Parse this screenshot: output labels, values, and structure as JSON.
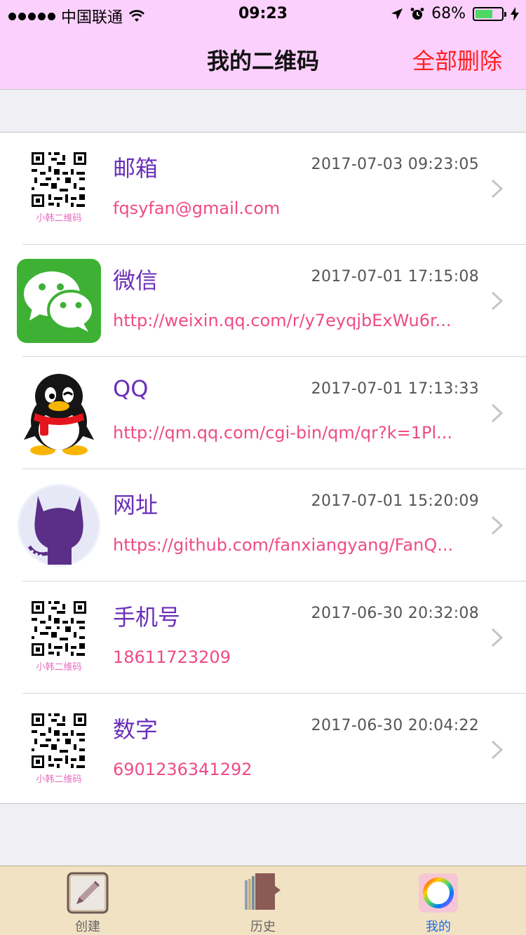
{
  "status_bar": {
    "carrier": "中国联通",
    "time": "09:23",
    "battery": "68%",
    "battery_level": 0.68
  },
  "nav": {
    "title": "我的二维码",
    "action_label": "全部删除"
  },
  "items": [
    {
      "title": "邮箱",
      "date": "2017-07-03 09:23:05",
      "content": "fqsyfan@gmail.com",
      "icon": "qr-code-icon",
      "thumb_caption": "小韩二维码"
    },
    {
      "title": "微信",
      "date": "2017-07-01 17:15:08",
      "content": "http://weixin.qq.com/r/y7eyqjbExWu6r...",
      "icon": "wechat-icon"
    },
    {
      "title": "QQ",
      "date": "2017-07-01 17:13:33",
      "content": "http://qm.qq.com/cgi-bin/qm/qr?k=1Pl...",
      "icon": "qq-penguin-icon"
    },
    {
      "title": "网址",
      "date": "2017-07-01 15:20:09",
      "content": "https://github.com/fanxiangyang/FanQ...",
      "icon": "github-octocat-icon"
    },
    {
      "title": "手机号",
      "date": "2017-06-30 20:32:08",
      "content": "18611723209",
      "icon": "qr-code-icon",
      "thumb_caption": "小韩二维码"
    },
    {
      "title": "数字",
      "date": "2017-06-30 20:04:22",
      "content": "6901236341292",
      "icon": "qr-code-icon",
      "thumb_caption": "小韩二维码"
    }
  ],
  "tabs": [
    {
      "label": "创建",
      "icon": "pencil-icon",
      "active": false
    },
    {
      "label": "历史",
      "icon": "books-icon",
      "active": false
    },
    {
      "label": "我的",
      "icon": "color-ring-icon",
      "active": true
    }
  ],
  "colors": {
    "nav_background": "#fcd0fc",
    "action_red": "#ff1f1f",
    "title_purple": "#6a2fb8",
    "content_pink": "#ee4b87",
    "tab_background": "#f1e2c4",
    "tab_active": "#1a6ee6"
  }
}
